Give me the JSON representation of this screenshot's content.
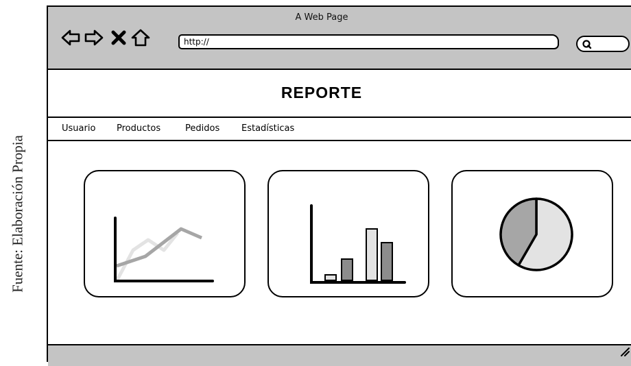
{
  "caption": {
    "text": "Fuente: Elaboración Propia"
  },
  "browser": {
    "window_title": "A Web Page",
    "url_value": "http://",
    "nav_icons": [
      "back-arrow-icon",
      "forward-arrow-icon",
      "stop-icon",
      "home-icon"
    ],
    "search_icon": "search-icon"
  },
  "page": {
    "title": "REPORTE",
    "menu": [
      "Usuario",
      "Productos",
      "Pedidos",
      "Estadísticas"
    ]
  },
  "cards": [
    {
      "icon": "line-chart-icon"
    },
    {
      "icon": "bar-chart-icon"
    },
    {
      "icon": "pie-chart-icon"
    }
  ],
  "colors": {
    "browser_chrome": "#c4c4c4",
    "chart_dark": "#8c8c8c",
    "chart_mid": "#a6a6a6",
    "chart_light": "#e3e3e3"
  }
}
